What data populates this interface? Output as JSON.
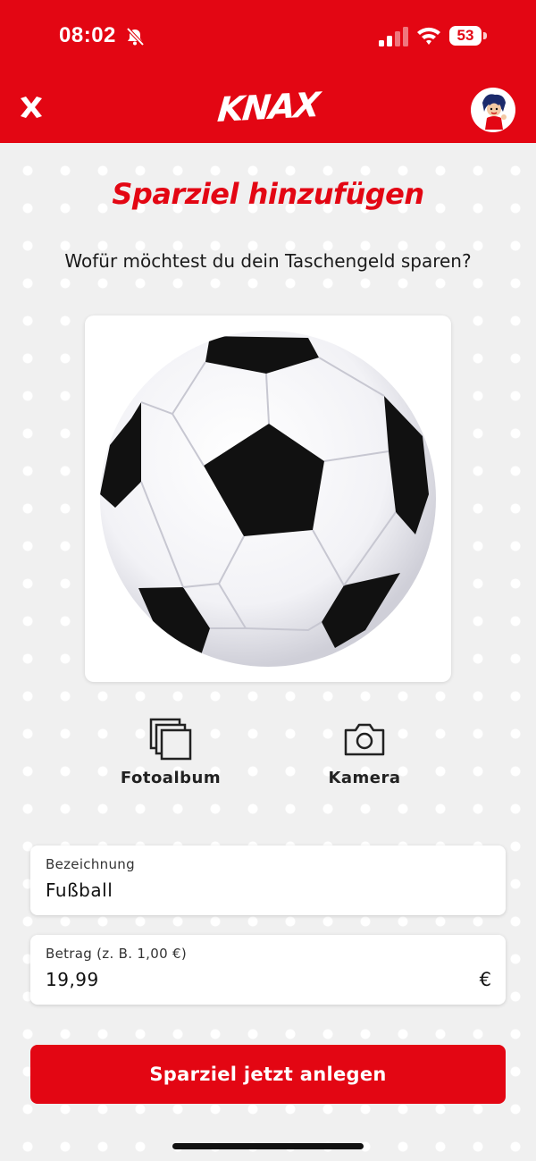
{
  "status_bar": {
    "time": "08:02",
    "battery": "53"
  },
  "header": {
    "logo": "KNAX",
    "accent_color": "#e30613",
    "close_icon": "close-x-icon",
    "avatar_icon": "character-avatar"
  },
  "main": {
    "title": "Sparziel hinzufügen",
    "subtitle": "Wofür möchtest du dein Taschengeld sparen?",
    "image_subject": "soccer-ball",
    "actions": [
      {
        "label": "Fotoalbum",
        "icon": "photo-album-icon"
      },
      {
        "label": "Kamera",
        "icon": "camera-icon"
      }
    ]
  },
  "form": {
    "name": {
      "label": "Bezeichnung",
      "value": "Fußball"
    },
    "amount": {
      "label": "Betrag (z. B. 1,00 €)",
      "value": "19,99",
      "currency": "€"
    },
    "submit_label": "Sparziel jetzt anlegen"
  }
}
